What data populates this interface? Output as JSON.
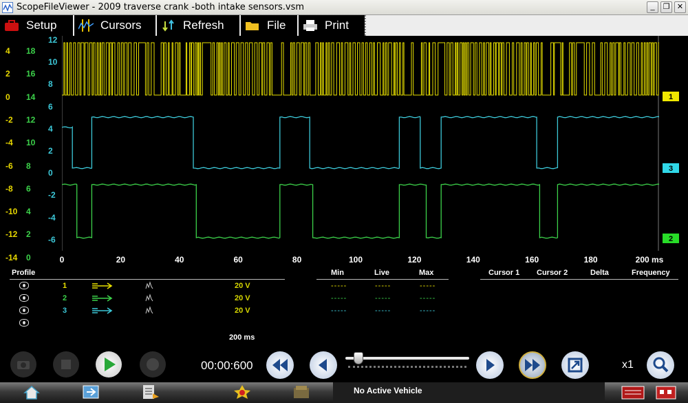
{
  "window": {
    "title": "ScopeFileViewer - 2009 traverse crank -both intake sensors.vsm",
    "minimize": "_",
    "restore": "❐",
    "close": "✕"
  },
  "toolbar": {
    "setup": "Setup",
    "cursors": "Cursors",
    "refresh": "Refresh",
    "file": "File",
    "print": "Print"
  },
  "y_scales": {
    "yellow": [
      "4",
      "2",
      "0",
      "-2",
      "-4",
      "-6",
      "-8",
      "-10",
      "-12",
      "-14"
    ],
    "green": [
      "18",
      "16",
      "14",
      "12",
      "10",
      "8",
      "6",
      "4",
      "2",
      "0"
    ],
    "cyan": [
      "12",
      "10",
      "8",
      "6",
      "4",
      "2",
      "0",
      "-2",
      "-4",
      "-6"
    ]
  },
  "chart_data": {
    "type": "line",
    "x_unit": "ms",
    "xlim": [
      0,
      200
    ],
    "x_ticks": [
      "0",
      "20",
      "40",
      "60",
      "80",
      "100",
      "120",
      "140",
      "160",
      "180",
      "200 ms"
    ],
    "series": [
      {
        "name": "1",
        "color": "#e8e000",
        "pattern": "high-frequency square wave",
        "low_level": 0,
        "high_level": 2.5,
        "levels_unit": "screen divisions above marker"
      },
      {
        "name": "3",
        "color": "#3cc8d8",
        "low": 0,
        "high": 5,
        "transitions_ms": [
          [
            0,
            4
          ],
          [
            3.5,
            0
          ],
          [
            10,
            5
          ],
          [
            44,
            0
          ],
          [
            73,
            5
          ],
          [
            83,
            0
          ],
          [
            113,
            5
          ],
          [
            120,
            0
          ],
          [
            127,
            5
          ],
          [
            159,
            0
          ],
          [
            166,
            5
          ],
          [
            200,
            5
          ]
        ]
      },
      {
        "name": "2",
        "color": "#3cd24a",
        "low": 0,
        "high": 5,
        "transitions_ms": [
          [
            0,
            5
          ],
          [
            5,
            0
          ],
          [
            10,
            5
          ],
          [
            45,
            0
          ],
          [
            73,
            5
          ],
          [
            84,
            0
          ],
          [
            113,
            5
          ],
          [
            122,
            0
          ],
          [
            127,
            5
          ],
          [
            160,
            0
          ],
          [
            166,
            5
          ],
          [
            200,
            5
          ]
        ]
      }
    ]
  },
  "markers": [
    {
      "label": "1",
      "color": "#f0e800"
    },
    {
      "label": "3",
      "color": "#30d8e8"
    },
    {
      "label": "2",
      "color": "#28dd28"
    }
  ],
  "panel": {
    "profile_header": "Profile",
    "min_header": "Min",
    "live_header": "Live",
    "max_header": "Max",
    "cursor1_header": "Cursor 1",
    "cursor2_header": "Cursor 2",
    "delta_header": "Delta",
    "frequency_header": "Frequency",
    "rows": [
      {
        "num": "1",
        "color": "#e8e000",
        "scale": "20 V",
        "min": "-----",
        "live": "-----",
        "max": "-----"
      },
      {
        "num": "2",
        "color": "#3cd24a",
        "scale": "20 V",
        "min": "-----",
        "live": "-----",
        "max": "-----"
      },
      {
        "num": "3",
        "color": "#3cc8d8",
        "scale": "20 V",
        "min": "-----",
        "live": "-----",
        "max": "-----"
      }
    ],
    "timebase": "200 ms"
  },
  "transport": {
    "time": "00:00:600",
    "zoom": "x1",
    "slider_position": 0.05
  },
  "taskbar": {
    "status": "No Active Vehicle"
  }
}
